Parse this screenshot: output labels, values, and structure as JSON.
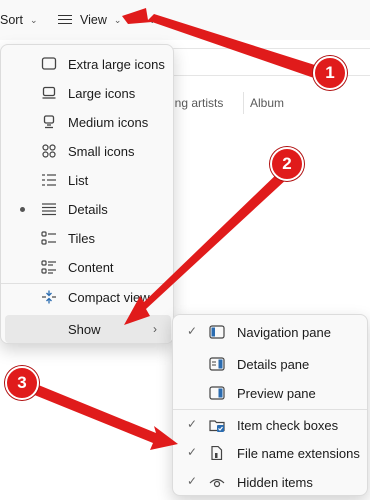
{
  "toolbar": {
    "sort_label": "Sort",
    "view_label": "View",
    "chevron_icon": "chevron-down-icon",
    "more_label": "…"
  },
  "columns": {
    "contributing_artists": "ing artists",
    "album": "Album"
  },
  "view_menu": {
    "items": [
      {
        "label": "Extra large icons",
        "icon": "extra-large-icons-icon",
        "selected": false
      },
      {
        "label": "Large icons",
        "icon": "large-icons-icon",
        "selected": false
      },
      {
        "label": "Medium icons",
        "icon": "medium-icons-icon",
        "selected": false
      },
      {
        "label": "Small icons",
        "icon": "small-icons-icon",
        "selected": false
      },
      {
        "label": "List",
        "icon": "list-icon",
        "selected": false
      },
      {
        "label": "Details",
        "icon": "details-icon",
        "selected": true
      },
      {
        "label": "Tiles",
        "icon": "tiles-icon",
        "selected": false
      },
      {
        "label": "Content",
        "icon": "content-icon",
        "selected": false
      }
    ],
    "compact_view": "Compact view",
    "show": "Show"
  },
  "show_menu": {
    "items": [
      {
        "label": "Navigation pane",
        "checked": true,
        "icon": "navigation-pane-icon"
      },
      {
        "label": "Details pane",
        "checked": false,
        "icon": "details-pane-icon"
      },
      {
        "label": "Preview pane",
        "checked": false,
        "icon": "preview-pane-icon"
      },
      {
        "label": "Item check boxes",
        "checked": true,
        "icon": "item-check-boxes-icon"
      },
      {
        "label": "File name extensions",
        "checked": true,
        "icon": "file-name-extensions-icon"
      },
      {
        "label": "Hidden items",
        "checked": true,
        "icon": "hidden-items-icon"
      }
    ]
  },
  "annotations": {
    "badge_1": "1",
    "badge_2": "2",
    "badge_3": "3",
    "color": "#e01b1b"
  }
}
